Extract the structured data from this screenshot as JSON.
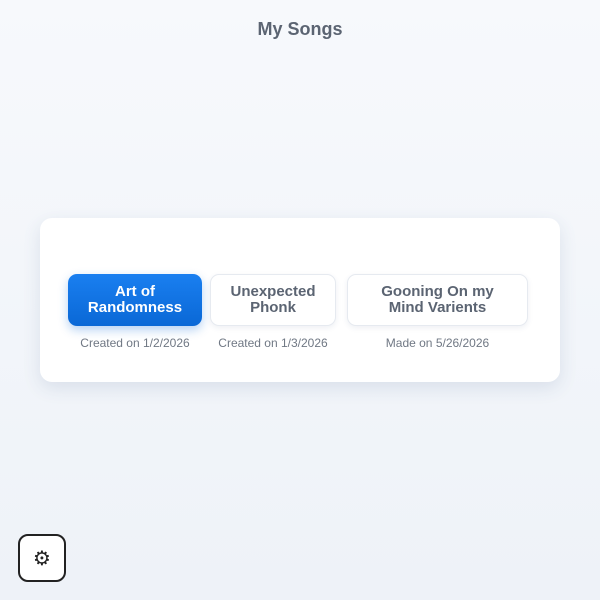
{
  "header": {
    "title": "My Songs"
  },
  "songs": [
    {
      "title": "Art of Randomness",
      "meta": "Created on 1/2/2026",
      "selected": true
    },
    {
      "title": "Unexpected Phonk",
      "meta": "Created on 1/3/2026",
      "selected": false
    },
    {
      "title": "Gooning On my Mind Varients",
      "meta": "Made on 5/26/2026",
      "selected": false
    }
  ],
  "settings": {
    "icon": "gear-icon",
    "glyph": "⚙"
  },
  "colors": {
    "accent": "#0a68d6",
    "text": "#5b6472",
    "meta_text": "#707884"
  }
}
